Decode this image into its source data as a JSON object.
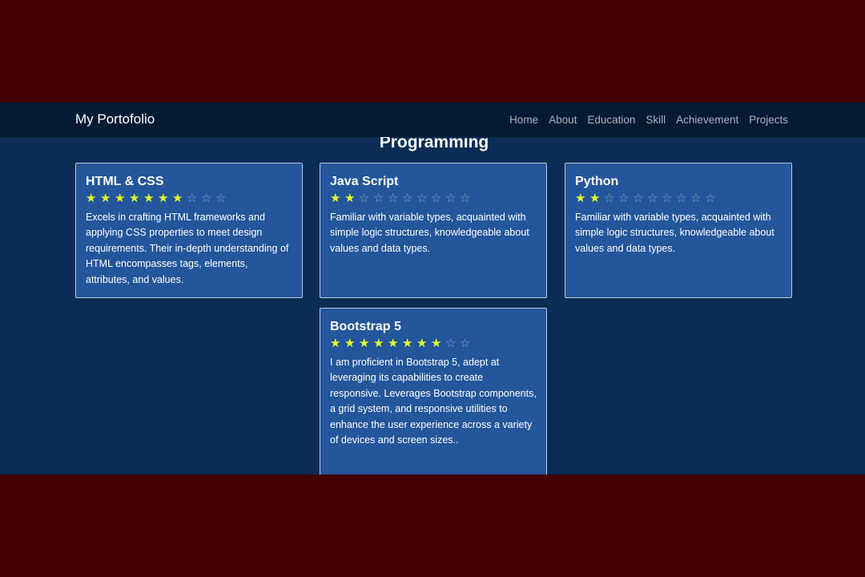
{
  "navbar": {
    "brand": "My Portofolio",
    "links": [
      "Home",
      "About",
      "Education",
      "Skill",
      "Achievement",
      "Projects"
    ]
  },
  "section": {
    "title": "Programming"
  },
  "skills": [
    {
      "title": "HTML & CSS",
      "rating": 7,
      "max_rating": 10,
      "description": "Excels in crafting HTML frameworks and applying CSS properties to meet design requirements. Their in-depth understanding of HTML encompasses tags, elements, attributes, and values."
    },
    {
      "title": "Java Script",
      "rating": 2,
      "max_rating": 10,
      "description": "Familiar with variable types, acquainted with simple logic structures, knowledgeable about values and data types."
    },
    {
      "title": "Python",
      "rating": 2,
      "max_rating": 10,
      "description": "Familiar with variable types, acquainted with simple logic structures, knowledgeable about values and data types."
    },
    {
      "title": "Bootstrap 5",
      "rating": 8,
      "max_rating": 10,
      "description": "I am proficient in Bootstrap 5, adept at leveraging its capabilities to create responsive. Leverages Bootstrap components, a grid system, and responsive utilities to enhance the user experience across a variety of devices and screen sizes.."
    }
  ],
  "colors": {
    "page_background": "#420001",
    "navbar_background": "#031a33",
    "section_background": "#0a2c55",
    "card_background": "#23569b",
    "star_filled": "#e4ff2a",
    "star_empty": "#8ea5c5"
  },
  "icons": {
    "star_filled": "star-filled-icon",
    "star_empty": "star-outline-icon"
  }
}
